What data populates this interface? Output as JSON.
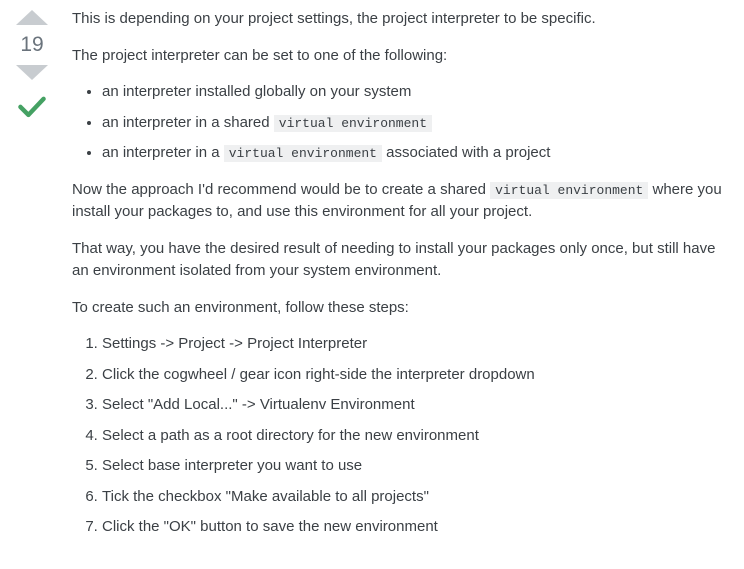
{
  "vote": {
    "count": "19"
  },
  "post": {
    "intro": "This is depending on your project settings, the project interpreter to be specific.",
    "interp_lead": "The project interpreter can be set to one of the following:",
    "bullets": {
      "b0": "an interpreter installed globally on your system",
      "b1_pre": "an interpreter in a shared ",
      "b1_code": "virtual environment",
      "b2_pre": "an interpreter in a ",
      "b2_code": "virtual environment",
      "b2_post": " associated with a project"
    },
    "rec_pre": "Now the approach I'd recommend would be to create a shared ",
    "rec_code": "virtual environment",
    "rec_post": " where you install your packages to, and use this environment for all your project.",
    "benefit": "That way, you have the desired result of needing to install your packages only once, but still have an environment isolated from your system environment.",
    "steps_lead": "To create such an environment, follow these steps:",
    "steps": {
      "s0": "Settings -> Project -> Project Interpreter",
      "s1": "Click the cogwheel / gear icon right-side the interpreter dropdown",
      "s2": "Select \"Add Local...\" -> Virtualenv Environment",
      "s3": "Select a path as a root directory for the new environment",
      "s4": "Select base interpreter you want to use",
      "s5": "Tick the checkbox \"Make available to all projects\"",
      "s6": "Click the \"OK\" button to save the new environment"
    }
  }
}
